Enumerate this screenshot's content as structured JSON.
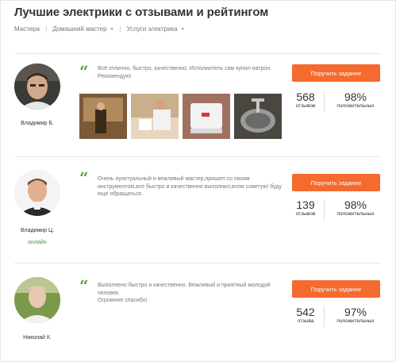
{
  "page": {
    "title": "Лучшие электрики с отзывами и рейтингом"
  },
  "breadcrumbs": [
    {
      "label": "Мастера",
      "has_caret": false
    },
    {
      "label": "Домашний мастер",
      "has_caret": true
    },
    {
      "label": "Услуги электрика",
      "has_caret": true
    }
  ],
  "colors": {
    "accent": "#f56a2f",
    "quote": "#5aa03c",
    "online": "#3a9a3a"
  },
  "cards": [
    {
      "name": "Владимир Б.",
      "online": "",
      "review": "Всё отлично, быстро, качественно. Исполнитель сам купил патрон. Рекомендую!",
      "button": "Поручить задание",
      "reviews_count": "568",
      "reviews_label": "отзывов",
      "positive_pct": "98%",
      "positive_label": "положительных"
    },
    {
      "name": "Владимир Ц.",
      "online": "онлайн",
      "review": "Очень пунктуальный и вежливый мастер,пришел со своим инструментом,все быстро и качественно выполнил,всем советую! буду ещё обращаться.",
      "button": "Поручить задание",
      "reviews_count": "139",
      "reviews_label": "отзывов",
      "positive_pct": "98%",
      "positive_label": "положительных"
    },
    {
      "name": "Николай К.",
      "online": "",
      "review": "Выполнено быстро и качественно. Вежливый и приятный молодой человек.\nОгромное спасибо!",
      "button": "Поручить задание",
      "reviews_count": "542",
      "reviews_label": "отзыва",
      "positive_pct": "97%",
      "positive_label": "положительных"
    }
  ]
}
